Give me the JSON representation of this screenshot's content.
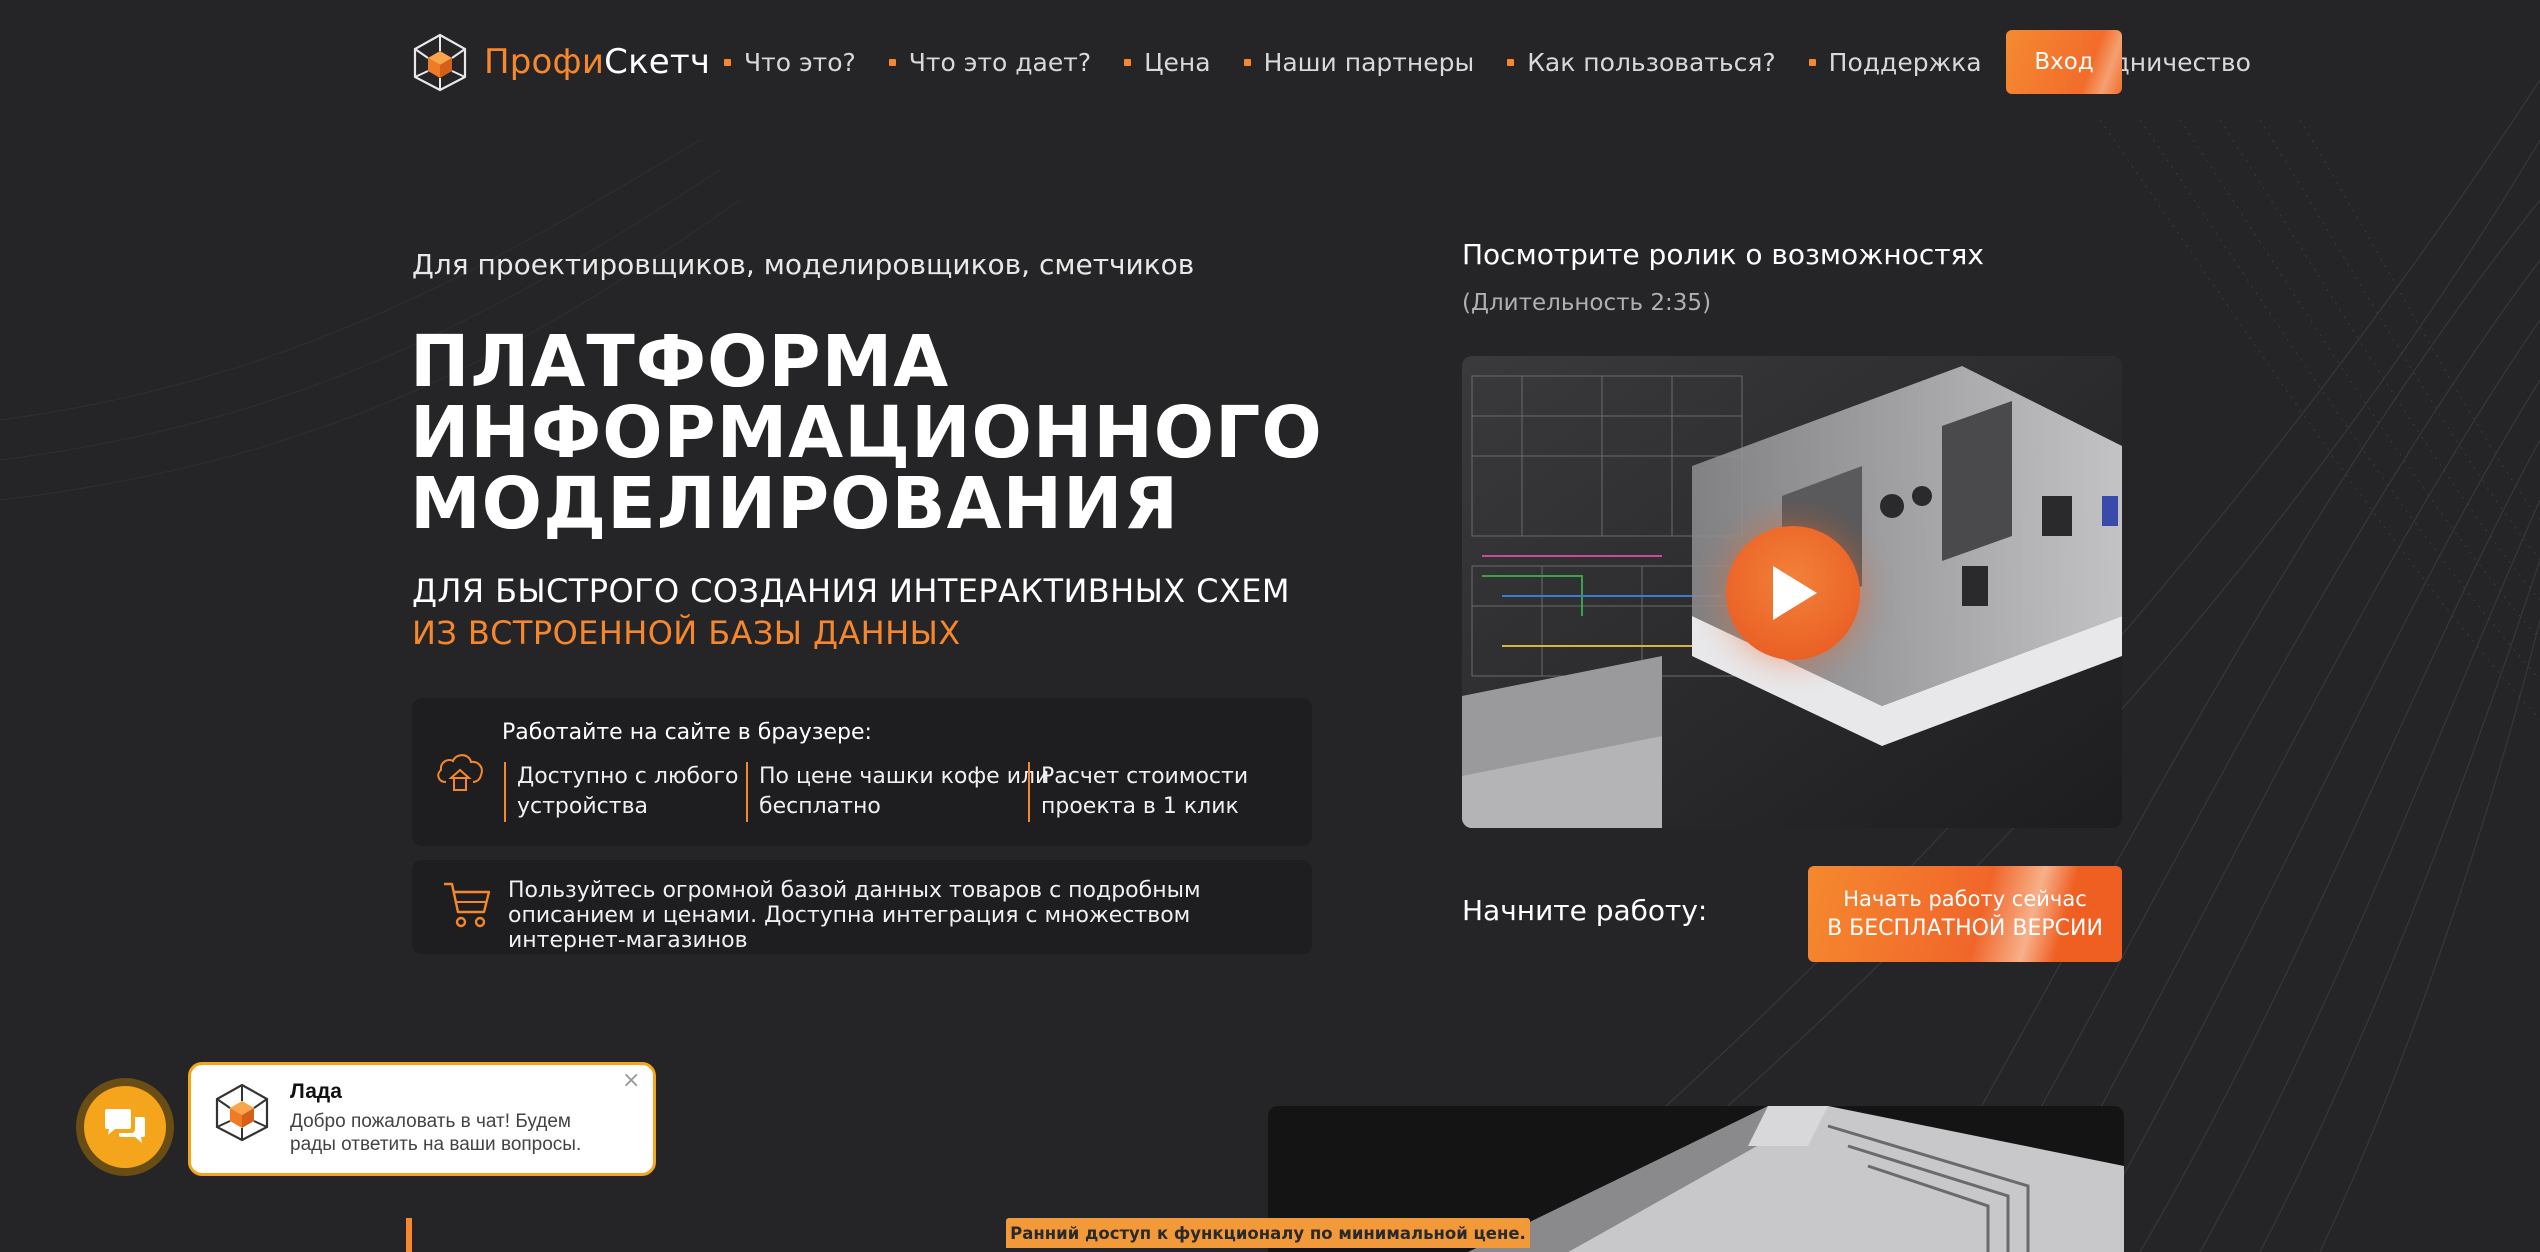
{
  "header": {
    "logo_part1": "Профи",
    "logo_part2": "Скетч",
    "nav": [
      "Что это?",
      "Что это дает?",
      "Цена",
      "Наши партнеры",
      "Как пользоваться?",
      "Поддержка",
      "Сотрудничество"
    ],
    "login_label": "Вход"
  },
  "hero": {
    "eyebrow": "Для проектировщиков, моделировщиков, сметчиков",
    "title_lines": [
      "ПЛАТФОРМА",
      "ИНФОРМАЦИОННОГО",
      "МОДЕЛИРОВАНИЯ"
    ],
    "subtitle_line1": "ДЛЯ БЫСТРОГО СОЗДАНИЯ ИНТЕРАКТИВНЫХ СХЕМ",
    "subtitle_line2": "ИЗ ВСТРОЕННОЙ БАЗЫ ДАННЫХ",
    "browser_card": {
      "heading": "Работайте на сайте в браузере:",
      "features": [
        {
          "line1": "Доступно с любого",
          "line2": "устройства"
        },
        {
          "line1": "По цене чашки кофе или",
          "line2": "бесплатно"
        },
        {
          "line1": "Расчет стоимости",
          "line2": "проекта в 1 клик"
        }
      ]
    },
    "database_card": {
      "text": "Пользуйтесь огромной базой данных товаров с подробным описанием и ценами. Доступна интеграция с множеством интернет-магазинов"
    }
  },
  "video": {
    "title": "Посмотрите ролик о возможностях",
    "duration": "(Длительность 2:35)"
  },
  "start": {
    "label": "Начните работу:",
    "button_line1": "Начать работу сейчас",
    "button_line2": "В БЕСПЛАТНОЙ ВЕРСИИ"
  },
  "early_access": "Ранний доступ к функционалу по минимальной цене.",
  "chat": {
    "agent_name": "Лада",
    "message": "Добро пожаловать в чат! Будем рады ответить на ваши вопросы.",
    "close_glyph": "×"
  },
  "colors": {
    "background": "#252527",
    "accent": "#f7872d",
    "button": "#f26c2a",
    "card": "#1e1e20",
    "chat_accent": "#f5a51b"
  }
}
